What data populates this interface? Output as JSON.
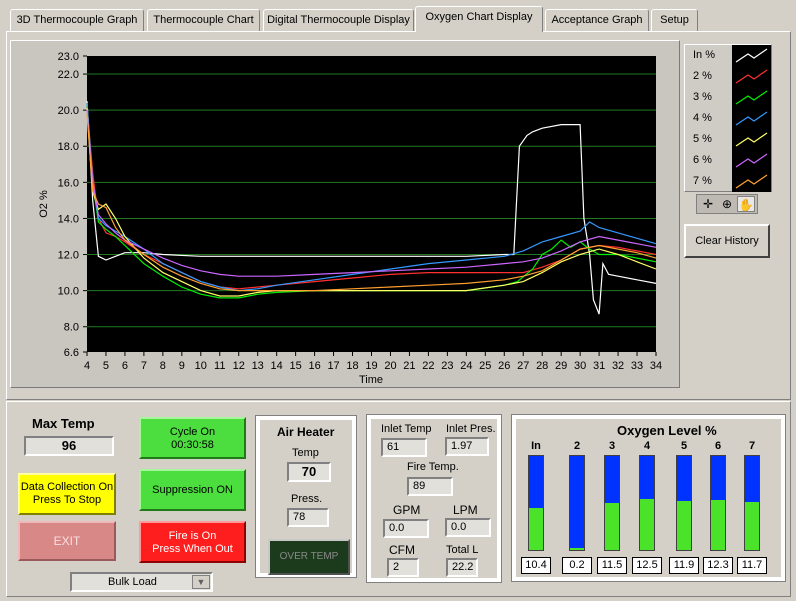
{
  "tabs": [
    {
      "label": "3D Thermocouple Graph"
    },
    {
      "label": "Thermocouple Chart"
    },
    {
      "label": "Digital Thermocouple Display"
    },
    {
      "label": "Oxygen Chart Display"
    },
    {
      "label": "Acceptance Graph"
    },
    {
      "label": "Setup"
    }
  ],
  "chart": {
    "ylabel": "O2 %",
    "xlabel": "Time"
  },
  "chart_data": {
    "type": "line",
    "ylabel": "O2 %",
    "xlabel": "Time",
    "xlim": [
      4,
      34
    ],
    "ylim": [
      6.6,
      23.0
    ],
    "x_ticks": [
      4,
      5,
      6,
      7,
      8,
      9,
      10,
      11,
      12,
      13,
      14,
      15,
      16,
      17,
      18,
      19,
      20,
      21,
      22,
      23,
      24,
      25,
      26,
      27,
      28,
      29,
      30,
      31,
      32,
      33,
      34
    ],
    "y_ticks": [
      6.6,
      8.0,
      10.0,
      12.0,
      14.0,
      16.0,
      18.0,
      20.0,
      22.0,
      23.0
    ],
    "y_tick_labels": [
      "6.6",
      "8.0",
      "10.0",
      "12.0",
      "14.0",
      "16.0",
      "18.0",
      "20.0",
      "22.0",
      "23.0"
    ],
    "grid": true,
    "legend": "right",
    "series": [
      {
        "name": "In %",
        "color": "#ffffff",
        "x": [
          4,
          4.3,
          4.6,
          5,
          5.5,
          6,
          7,
          8,
          10,
          12,
          14,
          16,
          18,
          20,
          22,
          24,
          26,
          26.5,
          26.8,
          27.2,
          27.5,
          28,
          29,
          30,
          30.2,
          30.5,
          30.7,
          31,
          31.2,
          31.5,
          32,
          33,
          34
        ],
        "y": [
          20.5,
          15,
          11.9,
          11.7,
          11.9,
          12.1,
          12.1,
          12.0,
          11.9,
          11.9,
          11.9,
          11.9,
          11.9,
          11.9,
          11.9,
          11.9,
          12.0,
          12.0,
          18.0,
          18.6,
          18.8,
          19.0,
          19.2,
          19.2,
          14.0,
          12.0,
          9.5,
          8.7,
          11.5,
          10.9,
          10.8,
          10.6,
          10.4
        ]
      },
      {
        "name": "2 %",
        "color": "#ff3030",
        "x": [
          4,
          4.3,
          4.6,
          5,
          5.5,
          6,
          7,
          8,
          9,
          10,
          11,
          12,
          14,
          16,
          18,
          20,
          22,
          24,
          26,
          27,
          28,
          29,
          30,
          31,
          32,
          33,
          34
        ],
        "y": [
          20.2,
          16.5,
          14,
          13.2,
          13.0,
          12.7,
          12.0,
          11.5,
          11.0,
          10.5,
          10.2,
          10.1,
          10.3,
          10.5,
          10.7,
          10.9,
          11.0,
          11.0,
          11.0,
          11.0,
          11.3,
          11.7,
          12.3,
          12.5,
          12.4,
          12.2,
          12.0
        ]
      },
      {
        "name": "3 %",
        "color": "#00ee00",
        "x": [
          4,
          4.3,
          4.6,
          5,
          5.5,
          6,
          7,
          8,
          9,
          10,
          11,
          12,
          13,
          14,
          16,
          18,
          20,
          22,
          24,
          26,
          26.7,
          27.5,
          28,
          28.5,
          29,
          29.5,
          30,
          30.5,
          31,
          32,
          33,
          34
        ],
        "y": [
          20.3,
          16,
          13.8,
          13.4,
          13.0,
          12.5,
          11.5,
          10.8,
          10.2,
          9.8,
          9.6,
          9.6,
          9.8,
          9.9,
          10.0,
          10.0,
          10.0,
          10.0,
          10.0,
          10.3,
          10.5,
          11.2,
          12.0,
          12.3,
          12.8,
          12.4,
          12.7,
          12.3,
          12.0,
          12.0,
          11.8,
          11.6
        ]
      },
      {
        "name": "4 %",
        "color": "#3399ff",
        "x": [
          4,
          4.3,
          4.6,
          5,
          5.5,
          6,
          7,
          8,
          9,
          10,
          11,
          12,
          13,
          14,
          16,
          18,
          20,
          22,
          24,
          26,
          27,
          28,
          29,
          30,
          30.5,
          31,
          32,
          33,
          34
        ],
        "y": [
          20.4,
          16,
          14,
          13.6,
          13.3,
          13.0,
          12.3,
          11.5,
          11.0,
          10.5,
          10.2,
          10.0,
          10.1,
          10.3,
          10.6,
          10.9,
          11.2,
          11.5,
          11.7,
          11.9,
          12.2,
          12.7,
          13.0,
          13.3,
          13.8,
          13.5,
          13.2,
          12.9,
          12.6
        ]
      },
      {
        "name": "5 %",
        "color": "#ffff66",
        "x": [
          4,
          4.3,
          4.6,
          5,
          5.5,
          6,
          7,
          8,
          9,
          10,
          11,
          12,
          13,
          14,
          16,
          18,
          20,
          22,
          24,
          26,
          27,
          28,
          29,
          30,
          31,
          32,
          33,
          34
        ],
        "y": [
          20.1,
          15.5,
          14.5,
          14.8,
          14.0,
          13.0,
          11.8,
          11.0,
          10.5,
          10.0,
          9.7,
          9.7,
          9.9,
          10.0,
          10.0,
          10.0,
          10.0,
          10.0,
          10.0,
          10.3,
          10.5,
          11.0,
          11.6,
          12.0,
          12.3,
          12.0,
          11.6,
          11.2
        ]
      },
      {
        "name": "6 %",
        "color": "#cc66ff",
        "x": [
          4,
          4.3,
          4.6,
          5,
          5.5,
          6,
          7,
          8,
          9,
          10,
          11,
          12,
          14,
          16,
          18,
          20,
          22,
          24,
          26,
          27,
          28,
          29,
          30,
          31,
          32,
          33,
          34
        ],
        "y": [
          20.0,
          16,
          14.2,
          13.7,
          13.2,
          12.8,
          12.3,
          11.8,
          11.4,
          11.1,
          10.9,
          10.8,
          10.8,
          10.9,
          11.0,
          11.1,
          11.2,
          11.3,
          11.5,
          11.6,
          11.8,
          12.2,
          12.7,
          13.0,
          12.8,
          12.6,
          12.4
        ]
      },
      {
        "name": "7 %",
        "color": "#ffa030",
        "x": [
          4,
          4.3,
          4.6,
          5,
          5.5,
          6,
          7,
          8,
          9,
          10,
          11,
          12,
          14,
          16,
          18,
          20,
          22,
          24,
          26,
          27,
          28,
          29,
          30,
          31,
          32,
          33,
          34
        ],
        "y": [
          19.8,
          15.5,
          14.8,
          14.6,
          13.5,
          12.8,
          12.0,
          11.3,
          10.8,
          10.4,
          10.1,
          10.0,
          10.0,
          10.0,
          10.1,
          10.2,
          10.3,
          10.4,
          10.6,
          10.8,
          11.1,
          11.7,
          12.3,
          12.5,
          12.3,
          12.1,
          11.8
        ]
      }
    ]
  },
  "graph_tools": {
    "icons": [
      "crosshair-icon",
      "zoom-icon",
      "hand-icon"
    ]
  },
  "clear_history": "Clear History",
  "max_temp": {
    "label": "Max Temp",
    "value": "96"
  },
  "data_collection": "Data Collection On\nPress To Stop",
  "exit": "EXIT",
  "cycle_on": {
    "line1": "Cycle On",
    "line2": "00:30:58"
  },
  "suppression": "Suppression ON",
  "fire": {
    "line1": "Fire is On",
    "line2": "Press When Out"
  },
  "bulk_load": "Bulk Load",
  "air_heater": {
    "title": "Air Heater",
    "temp_label": "Temp",
    "temp_value": "70",
    "press_label": "Press.",
    "press_value": "78",
    "over_temp": "OVER TEMP"
  },
  "readouts": {
    "inlet_temp_label": "Inlet Temp",
    "inlet_temp": "61",
    "inlet_pres_label": "Inlet Pres.",
    "inlet_pres": "1.97",
    "fire_temp_label": "Fire Temp.",
    "fire_temp": "89",
    "gpm_label": "GPM",
    "gpm": "0.0",
    "lpm_label": "LPM",
    "lpm": "0.0",
    "cfm_label": "CFM",
    "cfm": "2",
    "total_l_label": "Total L",
    "total_l": "22.2"
  },
  "oxygen_level": {
    "title": "Oxygen Level %",
    "scale_max_percent": 23,
    "bars": [
      {
        "label": "In",
        "value": 10.4,
        "text": "10.4"
      },
      {
        "label": "2",
        "value": 0.2,
        "text": "0.2"
      },
      {
        "label": "3",
        "value": 11.5,
        "text": "11.5"
      },
      {
        "label": "4",
        "value": 12.5,
        "text": "12.5"
      },
      {
        "label": "5",
        "value": 11.9,
        "text": "11.9"
      },
      {
        "label": "6",
        "value": 12.3,
        "text": "12.3"
      },
      {
        "label": "7",
        "value": 11.7,
        "text": "11.7"
      }
    ]
  }
}
